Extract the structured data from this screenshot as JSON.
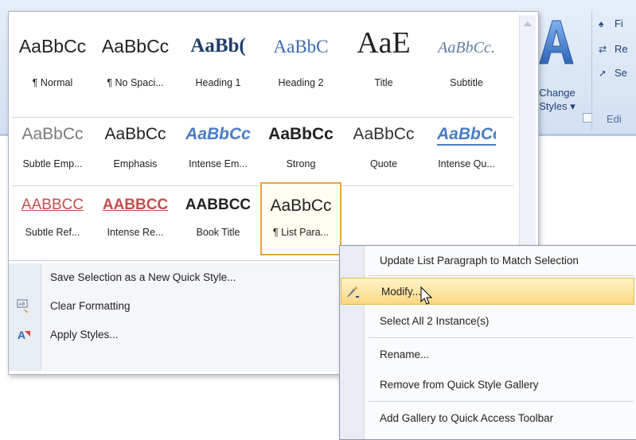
{
  "ribbon": {
    "change_styles_label_1": "Change",
    "change_styles_label_2": "Styles ▾",
    "find_label": "Fi",
    "replace_label": "Re",
    "select_label": "Se",
    "editing_group_label": "Edi"
  },
  "styles": [
    {
      "preview": "AaBbCc",
      "name": "¶ Normal"
    },
    {
      "preview": "AaBbCc",
      "name": "¶ No Spaci..."
    },
    {
      "preview": "AaBb(",
      "name": "Heading 1"
    },
    {
      "preview": "AaBbC",
      "name": "Heading 2"
    },
    {
      "preview": "AaE",
      "name": "Title"
    },
    {
      "preview": "AaBbCc.",
      "name": "Subtitle"
    },
    {
      "preview": "AaBbCc",
      "name": "Subtle Emp..."
    },
    {
      "preview": "AaBbCc",
      "name": "Emphasis"
    },
    {
      "preview": "AaBbCc",
      "name": "Intense Em..."
    },
    {
      "preview": "AaBbCc",
      "name": "Strong"
    },
    {
      "preview": "AaBbCc",
      "name": "Quote"
    },
    {
      "preview": "AaBbCc",
      "name": "Intense Qu..."
    },
    {
      "preview": "AABBCC",
      "name": "Subtle Ref..."
    },
    {
      "preview": "AABBCC",
      "name": "Intense Re..."
    },
    {
      "preview": "AABBCC",
      "name": "Book Title"
    },
    {
      "preview": "AaBbCc",
      "name": "¶ List Para..."
    }
  ],
  "gallery_menu": [
    {
      "label": "Save Selection as a New Quick Style...",
      "icon": "none"
    },
    {
      "label": "Clear Formatting",
      "icon": "clear-formatting-icon"
    },
    {
      "label": "Apply Styles...",
      "icon": "apply-styles-icon"
    }
  ],
  "context_menu": [
    {
      "label": "Update List Paragraph to Match Selection"
    },
    {
      "label": "Modify..."
    },
    {
      "label": "Select All 2 Instance(s)"
    },
    {
      "label": "Rename..."
    },
    {
      "label": "Remove from Quick Style Gallery"
    },
    {
      "label": "Add Gallery to Quick Access Toolbar"
    }
  ],
  "colors": {
    "accent_blue": "#2f5597",
    "selected_border": "#e8a33d",
    "highlight": "#fbd784"
  }
}
